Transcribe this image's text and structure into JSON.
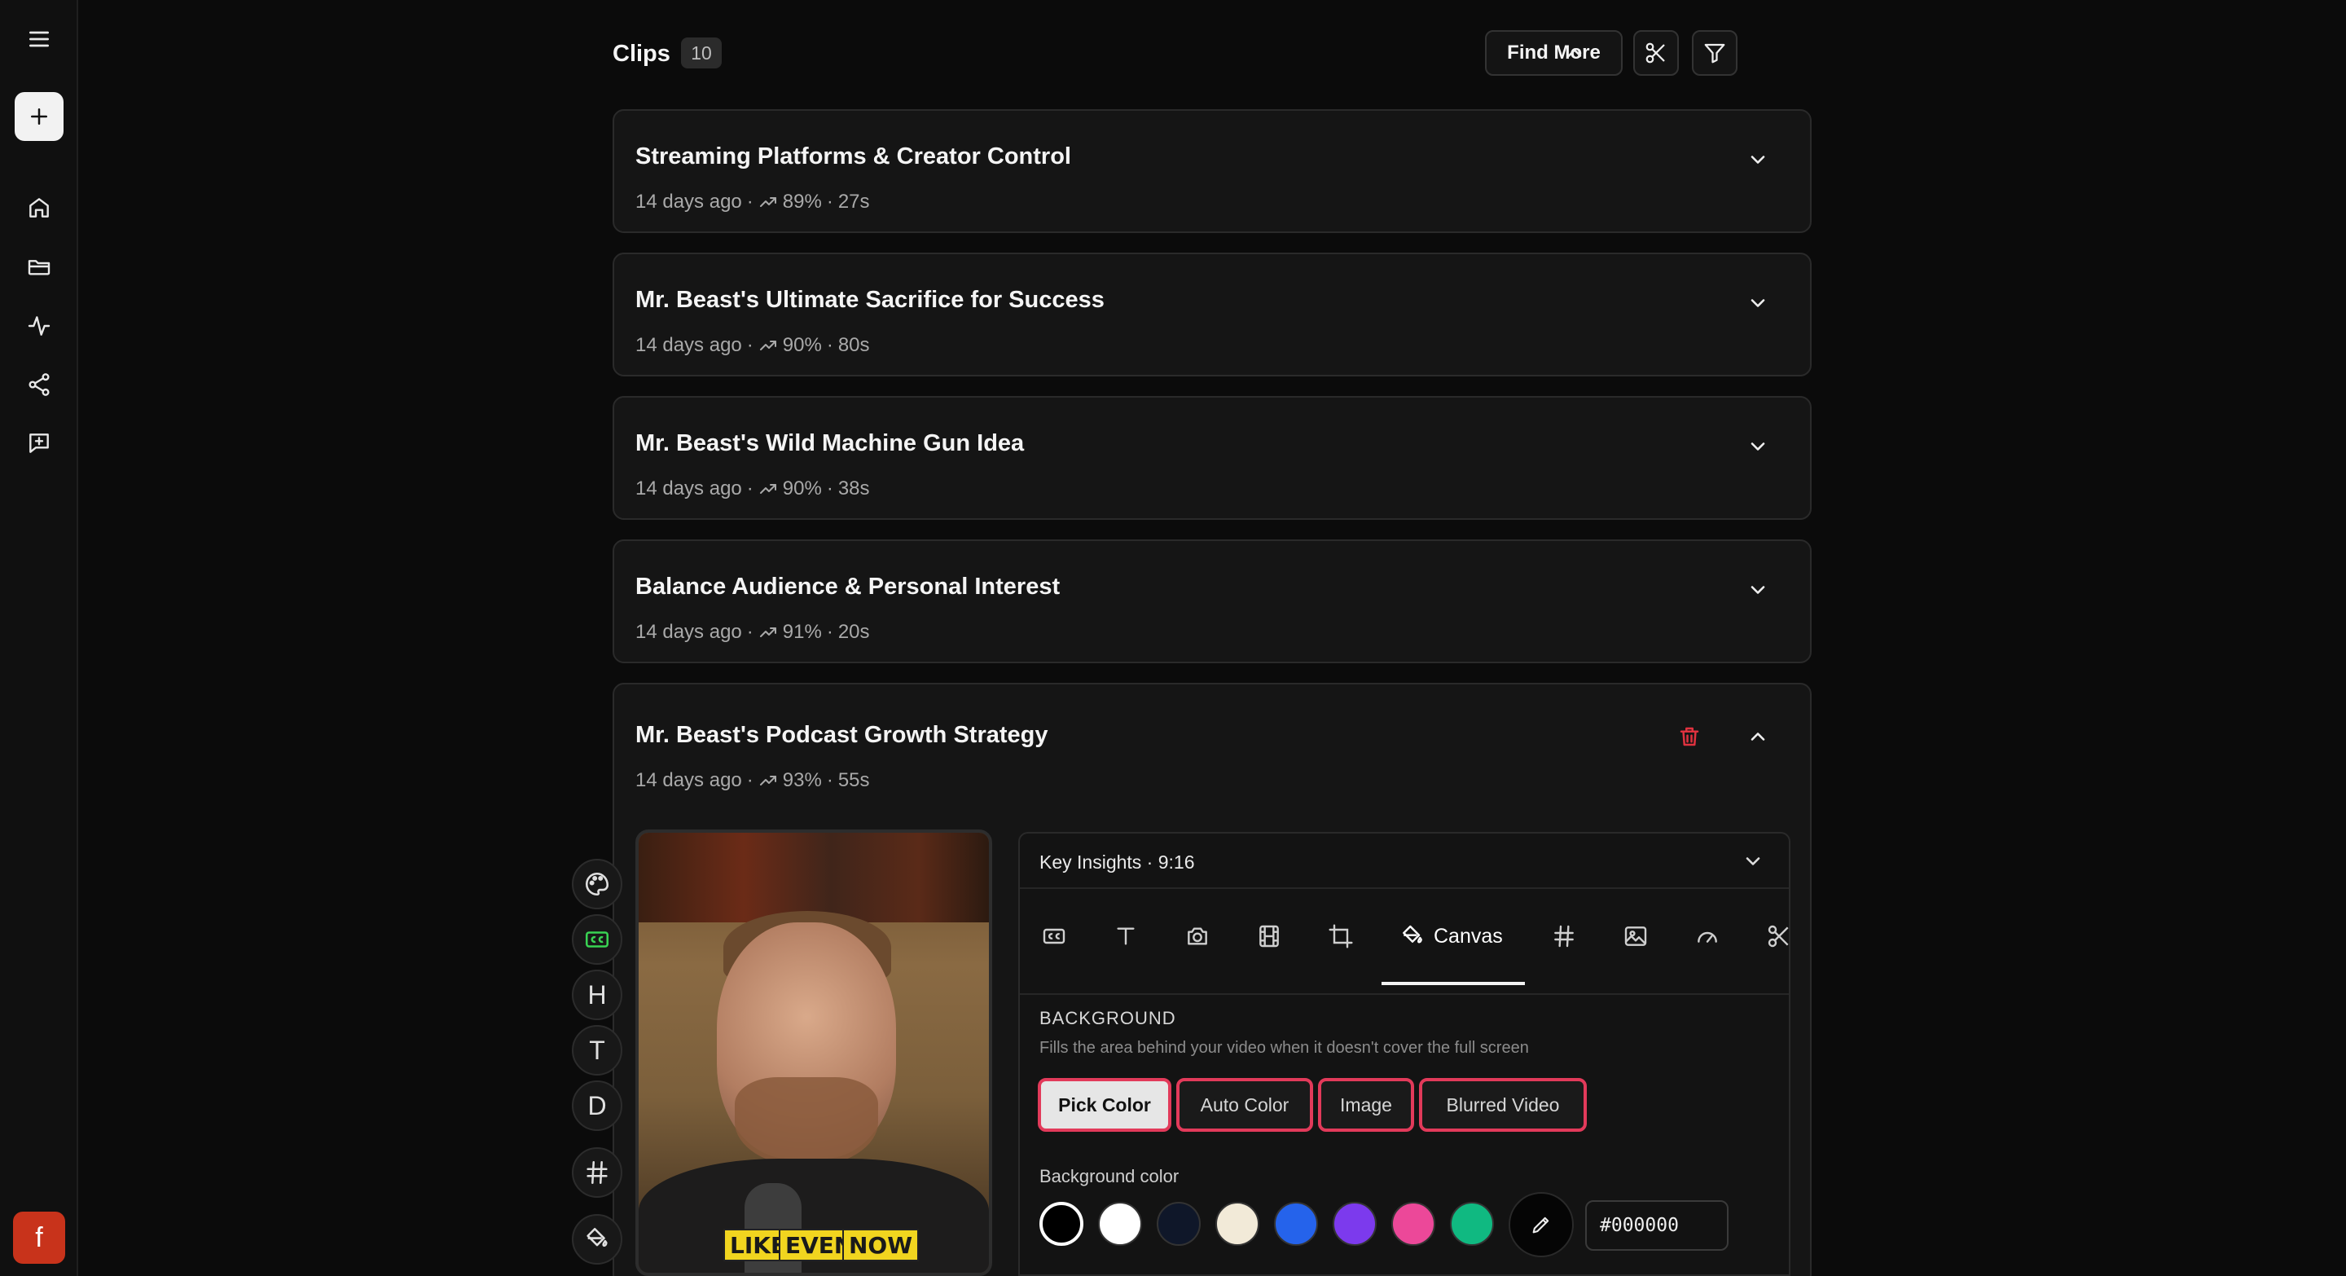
{
  "header": {
    "title": "Clips",
    "count": "10",
    "find_more_label": "Find More"
  },
  "clips": [
    {
      "title": "Streaming Platforms & Creator Control",
      "age": "14 days ago",
      "score": "89%",
      "duration": "27s"
    },
    {
      "title": "Mr. Beast's Ultimate Sacrifice for Success",
      "age": "14 days ago",
      "score": "90%",
      "duration": "80s"
    },
    {
      "title": "Mr. Beast's Wild Machine Gun Idea",
      "age": "14 days ago",
      "score": "90%",
      "duration": "38s"
    },
    {
      "title": "Balance Audience & Personal Interest",
      "age": "14 days ago",
      "score": "91%",
      "duration": "20s"
    },
    {
      "title": "Mr. Beast's Podcast Growth Strategy",
      "age": "14 days ago",
      "score": "93%",
      "duration": "55s"
    }
  ],
  "meta_separator": "·",
  "editor": {
    "tools": [
      {
        "icon": "palette-icon"
      },
      {
        "icon": "cc-icon",
        "label": "CC"
      },
      {
        "icon": "heading-icon",
        "label": "H"
      },
      {
        "icon": "text-icon",
        "label": "T"
      },
      {
        "icon": "d-icon",
        "label": "D"
      },
      {
        "icon": "hash-icon"
      },
      {
        "icon": "paint-bucket-icon"
      }
    ],
    "captions": [
      "LIKE",
      "EVEN",
      "NOW"
    ],
    "caption_color": "#f1d51f"
  },
  "panel": {
    "template_label": "Key Insights · 9:16",
    "active_tab": "Canvas",
    "tabs": [
      "captions-tab-icon",
      "text-tab-icon",
      "camera-tab-icon",
      "film-tab-icon",
      "crop-tab-icon",
      "canvas-tab-icon",
      "hash-tab-icon",
      "image-tab-icon",
      "speed-tab-icon",
      "scissors-tab-icon"
    ],
    "section_title": "BACKGROUND",
    "section_desc": "Fills the area behind your video when it doesn't cover the full screen",
    "options": [
      "Pick Color",
      "Auto Color",
      "Image",
      "Blurred Video"
    ],
    "selected_option": "Pick Color",
    "bg_color_label": "Background color",
    "swatches": [
      "#000000",
      "#ffffff",
      "#0f1729",
      "#f2ead8",
      "#2563eb",
      "#7c3aed",
      "#ec4899",
      "#10b981"
    ],
    "hex_value": "#000000"
  },
  "colors": {
    "accent_outline": "#e23a5a",
    "delete": "#e0323f",
    "avatar_bg": "#c8331b"
  },
  "user": {
    "avatar_letter": "f"
  }
}
